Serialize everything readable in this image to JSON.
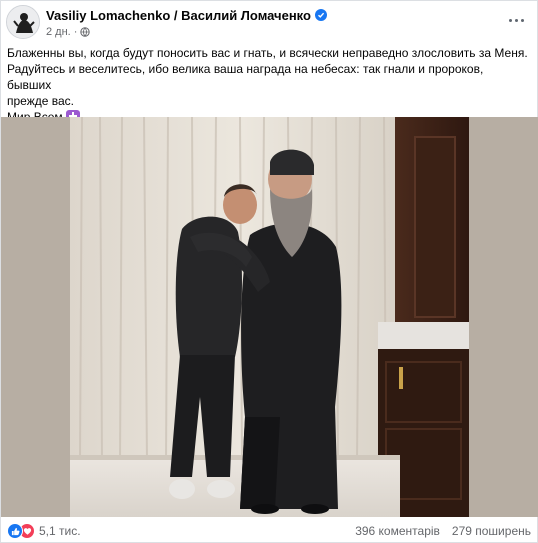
{
  "post": {
    "author": "Vasiliy Lomachenko / Василий Ломаченко",
    "time": "2 дн.",
    "verified": true,
    "privacy_icon": "globe-icon",
    "more_icon": "more-horizontal-icon",
    "text_line_1": "Блаженны вы, когда будут поносить вас и гнать, и всячески неправедно злословить за Меня.",
    "text_line_2": "Радуйтесь и веселитесь, ибо велика ваша награда на небесах: так гнали и пророков, бывших",
    "text_line_3": "прежде вас.",
    "text_line_4": "Мир Всем",
    "emoji": "orthodox-cross-emoji"
  },
  "reactions": {
    "types": [
      "like",
      "love"
    ],
    "count": "5,1 тис."
  },
  "stats": {
    "comments": "396 коментарів",
    "shares": "279 поширень"
  },
  "colors": {
    "accent": "#1877f2",
    "love": "#f33e58",
    "secondary_text": "#65676b"
  }
}
